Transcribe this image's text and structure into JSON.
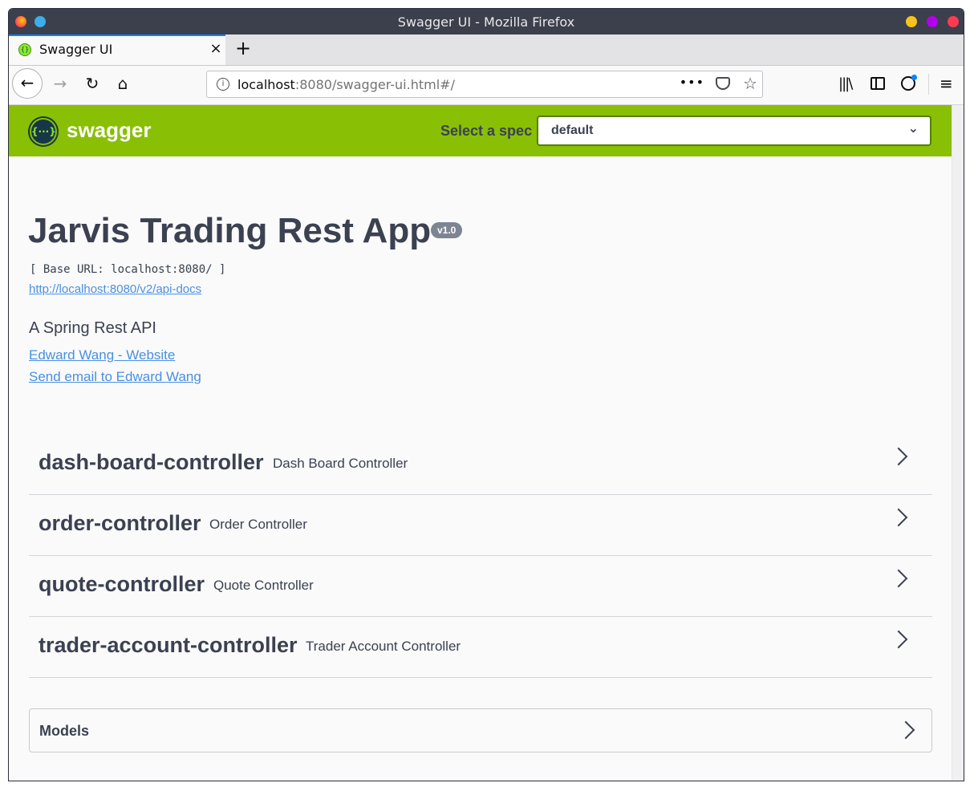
{
  "window": {
    "title": "Swagger UI - Mozilla Firefox"
  },
  "tabs": [
    {
      "title": "Swagger UI",
      "close": "×"
    }
  ],
  "new_tab_label": "+",
  "navigation": {
    "back": "←",
    "forward": "→",
    "reload": "↻",
    "home": "⌂",
    "url_host": "localhost",
    "url_rest": ":8080/swagger-ui.html#/",
    "page_actions": "•••",
    "bookmark_star": "☆",
    "library": "|||\\",
    "menu": "≡"
  },
  "swagger": {
    "logo_glyph": "{···}",
    "brand": "swagger",
    "spec_label": "Select a spec",
    "spec_value": "default",
    "spec_chevron": "⌄"
  },
  "info": {
    "title": "Jarvis Trading Rest App",
    "version": "v1.0",
    "base_url": "[ Base URL: localhost:8080/ ]",
    "api_docs_link": "http://localhost:8080/v2/api-docs",
    "description": "A Spring Rest API",
    "website_link": "Edward Wang - Website",
    "email_link": "Send email to Edward Wang"
  },
  "controllers": [
    {
      "name": "dash-board-controller",
      "description": "Dash Board Controller"
    },
    {
      "name": "order-controller",
      "description": "Order Controller"
    },
    {
      "name": "quote-controller",
      "description": "Quote Controller"
    },
    {
      "name": "trader-account-controller",
      "description": "Trader Account Controller"
    }
  ],
  "models": {
    "label": "Models"
  },
  "colors": {
    "swagger_green": "#89bf04",
    "text_dark": "#3b4151",
    "link_blue": "#4990e2",
    "version_badge": "#7d8492"
  }
}
